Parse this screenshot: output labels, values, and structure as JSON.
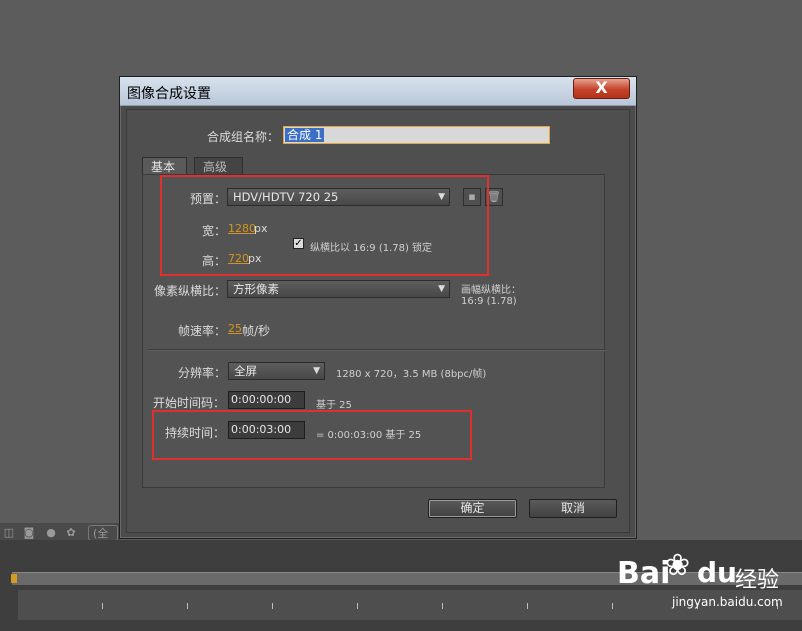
{
  "dialog": {
    "title": "图像合成设置",
    "close_glyph": "X",
    "name_label": "合成组名称：",
    "name_value": "合成 1",
    "tabs": [
      "基本",
      "高级"
    ],
    "preset_label": "预置：",
    "preset_value": "HDV/HDTV 720 25",
    "width_label": "宽：",
    "width_value": "1280",
    "width_unit": "px",
    "height_label": "高：",
    "height_value": "720",
    "height_unit": "px",
    "lock_label": "纵横比以 16:9 (1.78) 锁定",
    "pixel_aspect_label": "像素纵横比：",
    "pixel_aspect_value": "方形像素",
    "frame_aspect_label": "画幅纵横比：",
    "frame_aspect_value": "16:9 (1.78)",
    "fps_label": "帧速率：",
    "fps_value": "25",
    "fps_unit": "帧/秒",
    "resolution_label": "分辨率：",
    "resolution_value": "全屏",
    "resolution_info": "1280 x 720，3.5 MB (8bpc/帧)",
    "start_label": "开始时间码：",
    "start_value": "0:00:00:00",
    "start_info": "基于 25",
    "duration_label": "持续时间：",
    "duration_value": "0:00:03:00",
    "duration_info": "= 0:00:03:00  基于 25",
    "ok_label": "确定",
    "cancel_label": "取消"
  },
  "background": {
    "toolbar_btn_label": "(全",
    "watermark_brand": "Bai",
    "watermark_brand2": "du",
    "watermark_jingyan": "经验",
    "watermark_url": "jingyan.baidu.com"
  },
  "colors": {
    "accent_orange": "#d3951f",
    "highlight_red": "#e0302e",
    "close_red": "#c4432a"
  }
}
